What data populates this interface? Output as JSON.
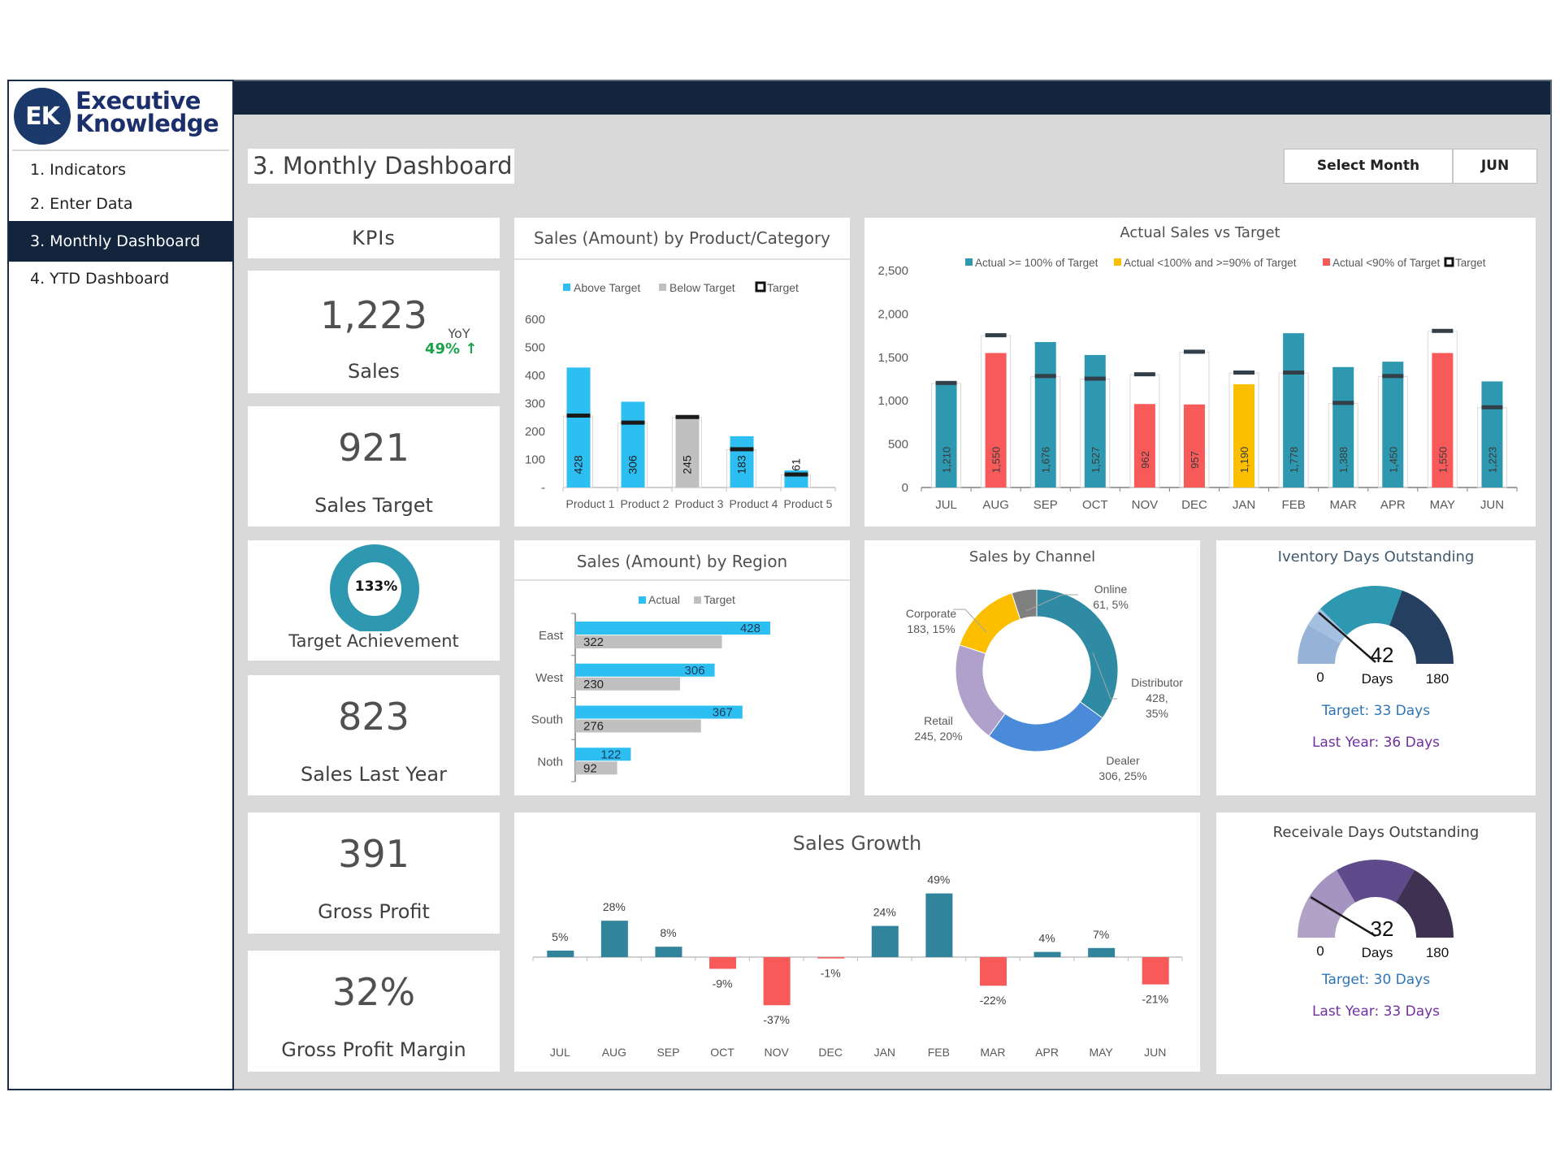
{
  "brand": {
    "logo_initials": "EK",
    "name_line1": "Executive",
    "name_line2": "Knowledge"
  },
  "nav": {
    "items": [
      {
        "label": "1. Indicators",
        "active": false
      },
      {
        "label": "2. Enter Data",
        "active": false
      },
      {
        "label": "3. Monthly Dashboard",
        "active": true
      },
      {
        "label": "4. YTD Dashboard",
        "active": false
      }
    ]
  },
  "page": {
    "title": "3. Monthly Dashboard"
  },
  "month_selector": {
    "label": "Select Month",
    "value": "JUN"
  },
  "kpis": {
    "header": "KPIs",
    "sales": {
      "value": "1,223",
      "label": "Sales",
      "yoy_label": "YoY",
      "yoy_value": "49%",
      "yoy_arrow": "↑"
    },
    "sales_target": {
      "value": "921",
      "label": "Sales Target"
    },
    "target_achievement": {
      "value": "133%",
      "label": "Target Achievement",
      "fraction": 1.0
    },
    "sales_last_year": {
      "value": "823",
      "label": "Sales Last Year"
    },
    "gross_profit": {
      "value": "391",
      "label": "Gross Profit"
    },
    "gross_profit_margin": {
      "value": "32%",
      "label": "Gross Profit Margin"
    }
  },
  "colors": {
    "navy": "#13243d",
    "teal": "#2e98b0",
    "cyan": "#2ebff2",
    "gray": "#c0c0c0",
    "red": "#f85a5a",
    "yellow": "#fcbf00",
    "green": "#1aa34a"
  },
  "chart_data": [
    {
      "id": "product",
      "type": "bar",
      "title": "Sales (Amount) by Product/Category",
      "legend": [
        "Above Target",
        "Below Target",
        "Target"
      ],
      "categories": [
        "Product 1",
        "Product 2",
        "Product 3",
        "Product 4",
        "Product 5"
      ],
      "series": [
        {
          "name": "Actual",
          "values": [
            428,
            306,
            245,
            183,
            61
          ]
        },
        {
          "name": "Target",
          "values": [
            255,
            230,
            250,
            135,
            45
          ]
        }
      ],
      "yticks": [
        "-",
        "100",
        "200",
        "300",
        "400",
        "500",
        "600"
      ],
      "ylim": [
        0,
        600
      ]
    },
    {
      "id": "actual_vs_target",
      "type": "bar",
      "title": "Actual Sales vs Target",
      "legend": [
        "Actual >= 100% of Target",
        "Actual <100% and >=90% of Target",
        "Actual <90% of Target",
        "Target"
      ],
      "categories": [
        "JUL",
        "AUG",
        "SEP",
        "OCT",
        "NOV",
        "DEC",
        "JAN",
        "FEB",
        "MAR",
        "APR",
        "MAY",
        "JUN"
      ],
      "series": [
        {
          "name": "Actual",
          "values": [
            1210,
            1550,
            1676,
            1527,
            962,
            957,
            1190,
            1778,
            1388,
            1450,
            1550,
            1223
          ],
          "labels": [
            "1,210",
            "1,550",
            "1,676",
            "1,527",
            "962",
            "957",
            "1,190",
            "1,778",
            "1,388",
            "1,450",
            "1,550",
            "1,223"
          ]
        },
        {
          "name": "Target",
          "values": [
            1200,
            1750,
            1280,
            1250,
            1300,
            1560,
            1320,
            1320,
            970,
            1280,
            1800,
            920
          ]
        }
      ],
      "yticks": [
        "0",
        "500",
        "1,000",
        "1,500",
        "2,000",
        "2,500"
      ],
      "ylim": [
        0,
        2500
      ]
    },
    {
      "id": "region",
      "type": "bar",
      "orientation": "horizontal",
      "title": "Sales (Amount) by Region",
      "legend": [
        "Actual",
        "Target"
      ],
      "categories": [
        "East",
        "West",
        "South",
        "Noth"
      ],
      "series": [
        {
          "name": "Actual",
          "values": [
            428,
            306,
            367,
            122
          ]
        },
        {
          "name": "Target",
          "values": [
            322,
            230,
            276,
            92
          ]
        }
      ],
      "xlim": [
        0,
        500
      ]
    },
    {
      "id": "channel",
      "type": "pie",
      "title": "Sales by Channel",
      "categories": [
        "Distributor",
        "Dealer",
        "Retail",
        "Corporate",
        "Online"
      ],
      "values": [
        428,
        306,
        245,
        183,
        61
      ],
      "labels": [
        "428, 35%",
        "306, 25%",
        "245, 20%",
        "183, 15%",
        "61, 5%"
      ],
      "colors": [
        "#2e8ba3",
        "#4a8ad8",
        "#b0a0cc",
        "#fcbf00",
        "#808080"
      ]
    },
    {
      "id": "growth",
      "type": "bar",
      "title": "Sales Growth",
      "categories": [
        "JUL",
        "AUG",
        "SEP",
        "OCT",
        "NOV",
        "DEC",
        "JAN",
        "FEB",
        "MAR",
        "APR",
        "MAY",
        "JUN"
      ],
      "values": [
        5,
        28,
        8,
        -9,
        -37,
        -1,
        24,
        49,
        -22,
        4,
        7,
        -21
      ],
      "labels": [
        "5%",
        "28%",
        "8%",
        "-9%",
        "-37%",
        "-1%",
        "24%",
        "49%",
        "-22%",
        "4%",
        "7%",
        "-21%"
      ],
      "ylim": [
        -50,
        60
      ]
    }
  ],
  "gauges": [
    {
      "id": "inventory",
      "title": "Iventory Days Outstanding",
      "value": 42,
      "value_text": "42",
      "unit": "Days",
      "min": 0,
      "max": 180,
      "min_text": "0",
      "max_text": "180",
      "target_text": "Target: 33 Days",
      "last_year_text": "Last Year: 36 Days",
      "bands": [
        30,
        45,
        110,
        180
      ],
      "band_colors": [
        "#95b3d7",
        "#a5bfe0",
        "#2e98b0",
        "#243f60"
      ]
    },
    {
      "id": "receivable",
      "title": "Receivale Days Outstanding",
      "value": 32,
      "value_text": "32",
      "unit": "Days",
      "min": 0,
      "max": 180,
      "min_text": "0",
      "max_text": "180",
      "target_text": "Target: 30 Days",
      "last_year_text": "Last Year: 33 Days",
      "bands": [
        30,
        60,
        120,
        180
      ],
      "band_colors": [
        "#b3a2c7",
        "#a593c2",
        "#5f4a8b",
        "#3f3151"
      ]
    }
  ]
}
